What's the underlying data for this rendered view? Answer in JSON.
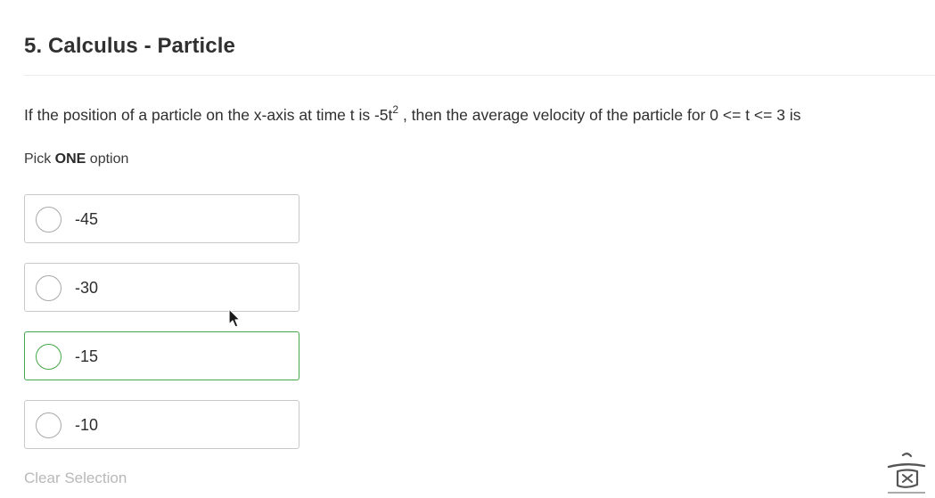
{
  "question": {
    "title": "5. Calculus - Particle",
    "text_before": "If the position of a particle on the x-axis at time t is -5t",
    "exponent": "2",
    "text_after": " , then the average velocity of the particle for 0 <= t <= 3 is",
    "pick_prefix": "Pick ",
    "pick_bold": "ONE",
    "pick_suffix": " option"
  },
  "options": [
    {
      "label": "-45",
      "selected": false
    },
    {
      "label": "-30",
      "selected": false
    },
    {
      "label": "-15",
      "selected": false,
      "hovered": true
    },
    {
      "label": "-10",
      "selected": false
    }
  ],
  "clear_label": "Clear Selection",
  "colors": {
    "hover_border": "#45a84a",
    "default_border": "#c9c9c9",
    "muted_text": "#b8b8b8"
  },
  "icons": {
    "cursor": "mouse-pointer-icon",
    "watermark": "watermark-logo-icon"
  }
}
